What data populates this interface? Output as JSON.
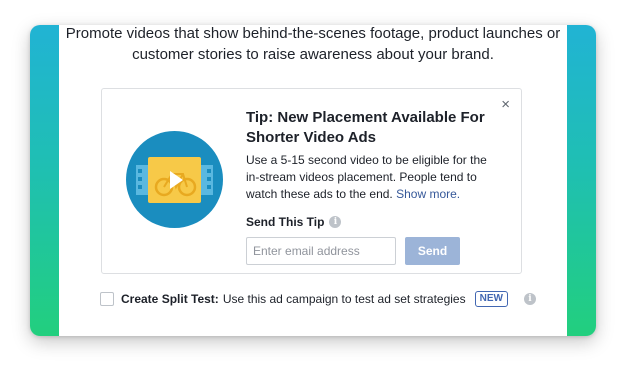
{
  "intro": {
    "line1": "Promote videos that show behind-the-scenes footage, product launches or",
    "line2": "customer stories to raise awareness about your brand."
  },
  "tip": {
    "title": "Tip: New Placement Available For Shorter Video Ads",
    "body": "Use a 5-15 second video to be eligible for the in-stream videos placement. People tend to watch these ads to the end. ",
    "show_more": "Show more.",
    "send_label": "Send This Tip",
    "email_placeholder": "Enter email address",
    "send_button": "Send",
    "close_icon": "×",
    "info_icon": "i",
    "illustration_icon": "bicycle-video-icon"
  },
  "split_test": {
    "label": "Create Split Test:",
    "description": "Use this ad campaign to test ad set strategies",
    "badge": "NEW",
    "info_icon": "i"
  },
  "colors": {
    "frame_top": "#21b3d4",
    "frame_bottom": "#22cf7e",
    "link": "#365899",
    "send_button": "#9cb4d8",
    "badge": "#4267b2"
  }
}
